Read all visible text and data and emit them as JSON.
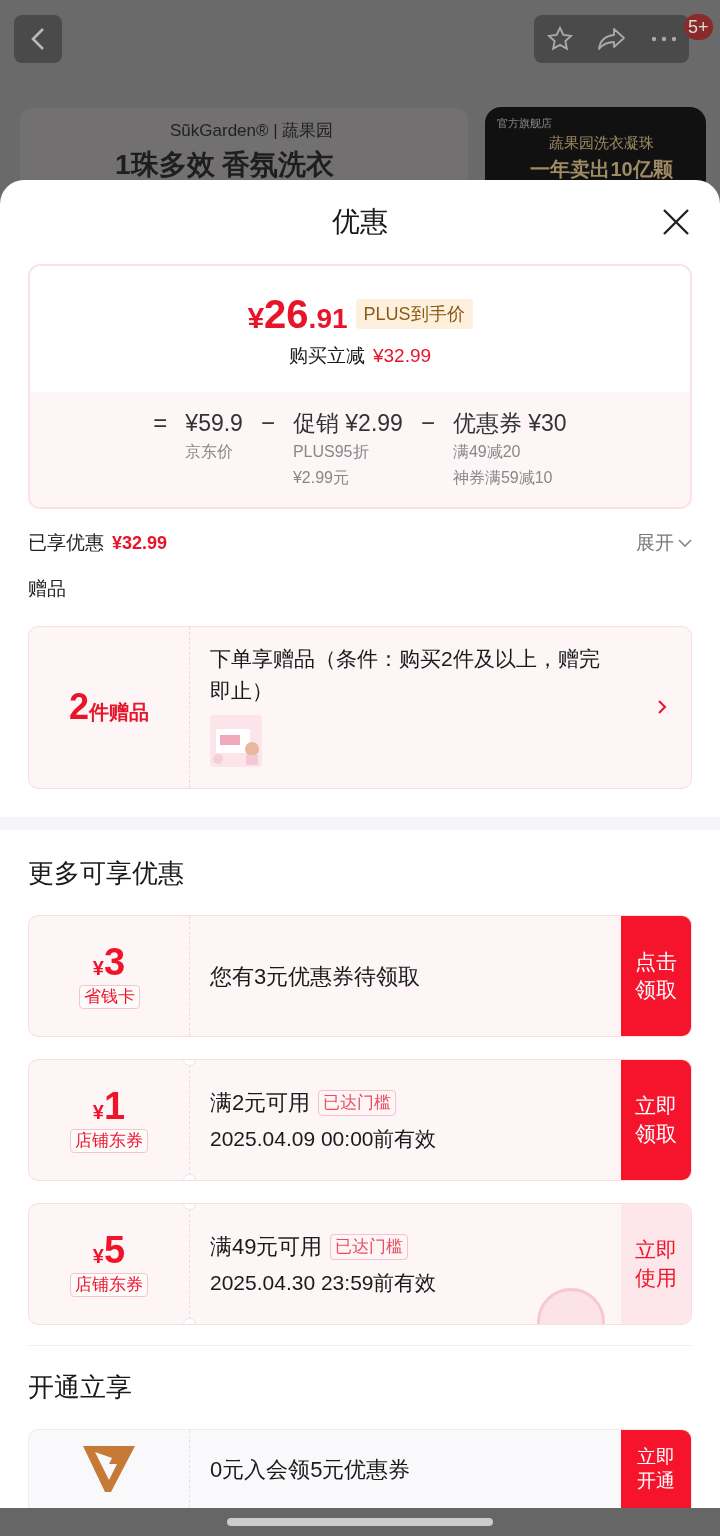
{
  "background": {
    "badge": "5+",
    "brand": "SũkGarden® | 蔬果园",
    "headline": "1珠多效 香氛洗衣",
    "ad_store": "官方旗舰店",
    "ad_line1": "蔬果园洗衣凝珠",
    "ad_line2": "一年卖出10亿颗"
  },
  "sheet": {
    "title": "优惠",
    "price": {
      "currency": "¥",
      "integer": "26",
      "decimal": ".91",
      "tag": "PLUS到手价",
      "saving_label": "购买立减",
      "saving": "¥32.99"
    },
    "breakdown": [
      {
        "op": "=",
        "amount": "¥59.9",
        "notes": [
          "京东价"
        ]
      },
      {
        "op": "−",
        "amount": "促销 ¥2.99",
        "notes": [
          "PLUS95折",
          "¥2.99元"
        ]
      },
      {
        "op": "−",
        "amount": "优惠券 ¥30",
        "notes": [
          "满49减20",
          "神券满59减10"
        ]
      }
    ],
    "enjoyed_label": "已享优惠",
    "enjoyed": "¥32.99",
    "expand": "展开",
    "expanded": false,
    "gifts_heading": "赠品",
    "gift": {
      "count": "2",
      "count_label": "件赠品",
      "text": "下单享赠品（条件：购买2件及以上，赠完即止）"
    },
    "more_heading": "更多可享优惠",
    "coupons": [
      {
        "currency": "¥",
        "amount": "3",
        "tag": "省钱卡",
        "title": "您有3元优惠券待领取",
        "button": "点击领取",
        "filled": true,
        "notched": false,
        "stamp": false
      },
      {
        "currency": "¥",
        "amount": "1",
        "tag": "店铺东券",
        "title": "满2元可用",
        "badge": "已达门槛",
        "validity": "2025.04.09 00:00前有效",
        "button": "立即领取",
        "filled": true,
        "notched": true,
        "stamp": false
      },
      {
        "currency": "¥",
        "amount": "5",
        "tag": "店铺东券",
        "title": "满49元可用",
        "badge": "已达门槛",
        "validity": "2025.04.30 23:59前有效",
        "button": "立即使用",
        "filled": false,
        "notched": true,
        "stamp": true
      }
    ],
    "open_heading": "开通立享",
    "member": {
      "text": "0元入会领5元优惠券",
      "button": "立即开通"
    }
  }
}
